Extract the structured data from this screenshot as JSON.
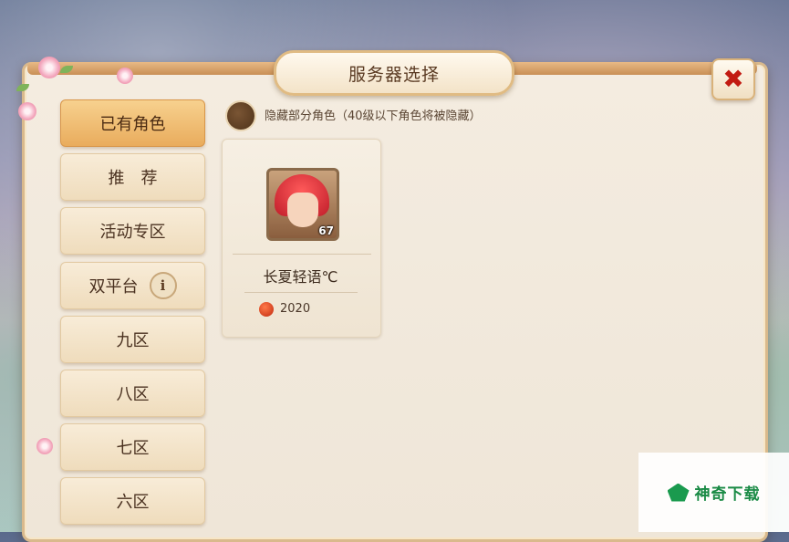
{
  "dialog": {
    "title": "服务器选择",
    "close_symbol": "✖"
  },
  "tabs": [
    {
      "label": "已有角色",
      "active": true
    },
    {
      "label": "推　荐",
      "active": false
    },
    {
      "label": "活动专区",
      "active": false
    },
    {
      "label": "双平台",
      "active": false,
      "info_icon": "i"
    },
    {
      "label": "九区",
      "active": false
    },
    {
      "label": "八区",
      "active": false
    },
    {
      "label": "七区",
      "active": false
    },
    {
      "label": "六区",
      "active": false
    }
  ],
  "hide_toggle": {
    "label": "隐藏部分角色（40级以下角色将被隐藏）"
  },
  "role_card": {
    "level": "67",
    "name": "长夏轻语℃",
    "server": "2020"
  },
  "watermark": {
    "text": "神奇下载"
  }
}
